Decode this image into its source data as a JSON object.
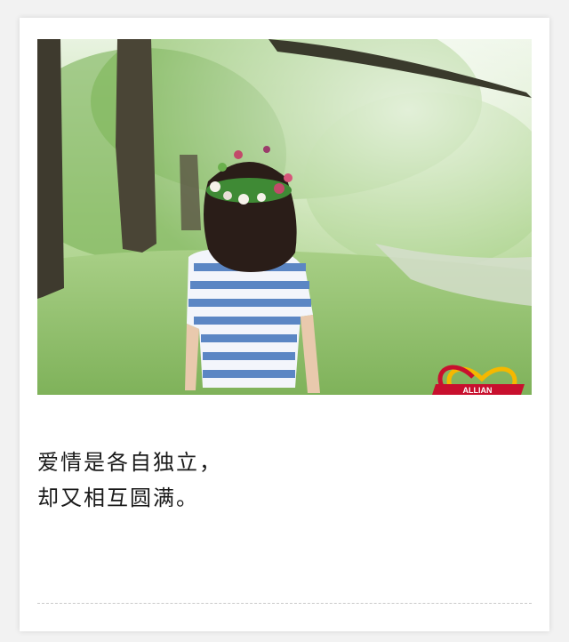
{
  "photo": {
    "logo_text": "ALLIAN"
  },
  "caption": {
    "line1": "爱情是各自独立，",
    "line2": "却又相互圆满。"
  },
  "colors": {
    "logo_red": "#c8102e",
    "logo_yellow": "#f5b800",
    "stripe_blue": "#5b86c4"
  }
}
